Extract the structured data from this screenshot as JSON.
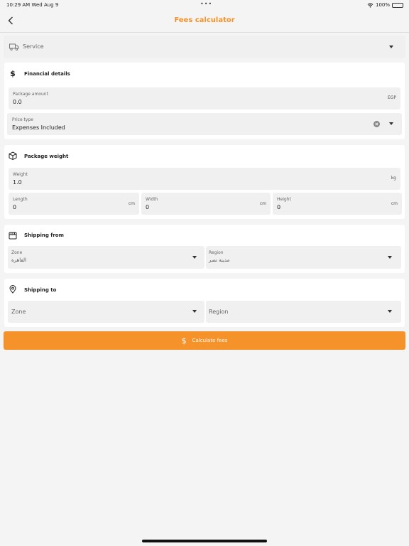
{
  "status": {
    "time": "10:29 AM  Wed Aug 9",
    "dots": "•••",
    "battery": "100%",
    "battery_level": 1.0
  },
  "header": {
    "title": "Fees calculator"
  },
  "service": {
    "placeholder": "Service"
  },
  "financial": {
    "title": "Financial details",
    "package_amount_label": "Package amount",
    "package_amount_value": "0.0",
    "package_amount_unit": "EGP",
    "price_type_label": "Price type",
    "price_type_value": "Expenses Included"
  },
  "weight": {
    "title": "Package weight",
    "weight_label": "Weight",
    "weight_value": "1.0",
    "weight_unit": "kg",
    "length_label": "Length",
    "length_value": "0",
    "length_unit": "cm",
    "width_label": "Width",
    "width_value": "0",
    "width_unit": "cm",
    "height_label": "Height",
    "height_value": "0",
    "height_unit": "cm"
  },
  "shipping_from": {
    "title": "Shipping from",
    "zone_label": "Zone",
    "zone_value": "القاهرة",
    "region_label": "Region",
    "region_value": "مدينة نصر"
  },
  "shipping_to": {
    "title": "Shipping to",
    "zone_placeholder": "Zone",
    "region_placeholder": "Region"
  },
  "calculate": {
    "label": "Calculate fees"
  },
  "colors": {
    "accent": "#f6922a",
    "field_bg": "#f0f0f0",
    "card_bg": "#ffffff",
    "page_bg": "#f4f4f4"
  }
}
